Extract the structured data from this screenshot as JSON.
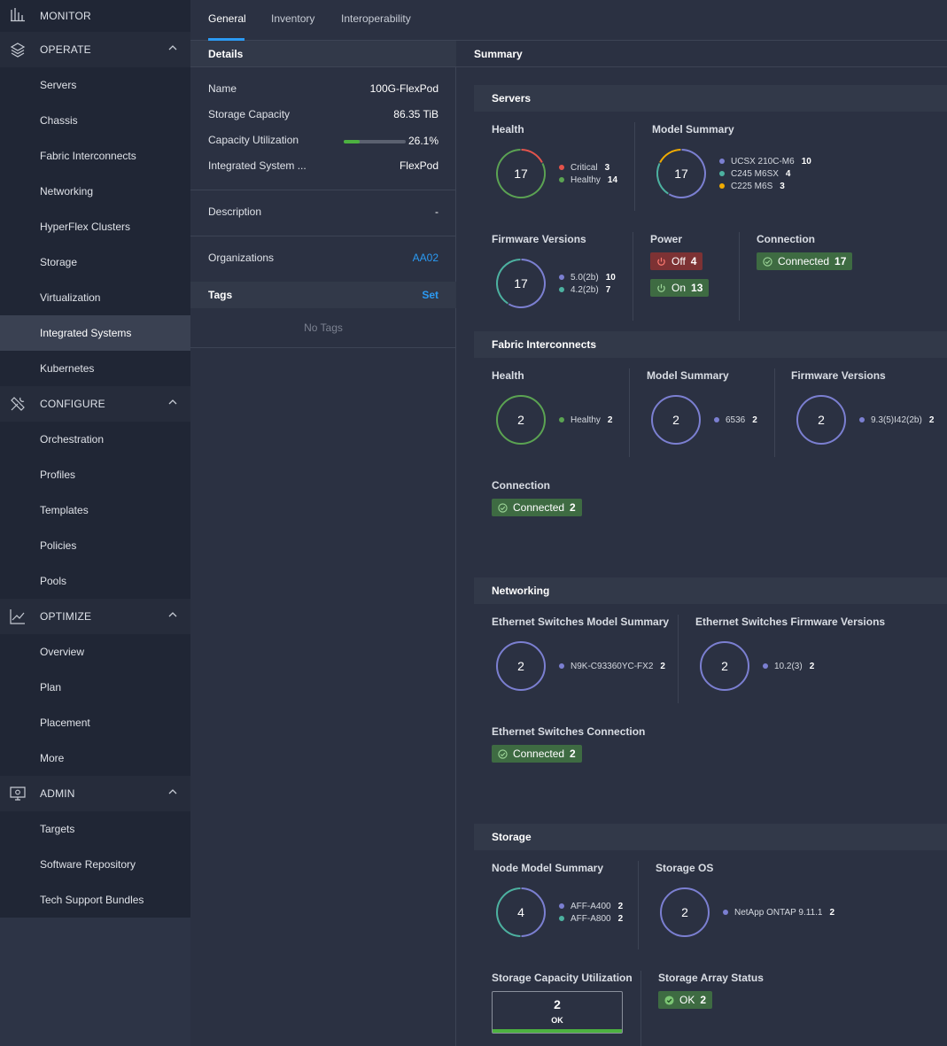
{
  "sidebar": {
    "monitor": "MONITOR",
    "operate": "OPERATE",
    "operate_items": [
      "Servers",
      "Chassis",
      "Fabric Interconnects",
      "Networking",
      "HyperFlex Clusters",
      "Storage",
      "Virtualization",
      "Integrated Systems",
      "Kubernetes"
    ],
    "configure": "CONFIGURE",
    "configure_items": [
      "Orchestration",
      "Profiles",
      "Templates",
      "Policies",
      "Pools"
    ],
    "optimize": "OPTIMIZE",
    "optimize_items": [
      "Overview",
      "Plan",
      "Placement",
      "More"
    ],
    "admin": "ADMIN",
    "admin_items": [
      "Targets",
      "Software Repository",
      "Tech Support Bundles"
    ]
  },
  "tabs": [
    "General",
    "Inventory",
    "Interoperability"
  ],
  "details": {
    "header": "Details",
    "name_label": "Name",
    "name_value": "100G-FlexPod",
    "storage_label": "Storage Capacity",
    "storage_value": "86.35 TiB",
    "util_label": "Capacity Utilization",
    "util_value": "26.1%",
    "util_fraction": 0.261,
    "type_label": "Integrated System ...",
    "type_value": "FlexPod",
    "desc_label": "Description",
    "desc_value": "-",
    "org_label": "Organizations",
    "org_value": "AA02",
    "tags_header": "Tags",
    "tags_action": "Set",
    "no_tags": "No Tags"
  },
  "summary": {
    "header": "Summary",
    "servers": {
      "title": "Servers",
      "health": {
        "title": "Health",
        "total": "17",
        "items": [
          {
            "label": "Critical",
            "count": "3",
            "color": "#e5534b"
          },
          {
            "label": "Healthy",
            "count": "14",
            "color": "#5ba352"
          }
        ]
      },
      "model": {
        "title": "Model Summary",
        "total": "17",
        "items": [
          {
            "label": "UCSX 210C-M6",
            "count": "10",
            "color": "#7b7fd1"
          },
          {
            "label": "C245 M6SX",
            "count": "4",
            "color": "#4cb1a0"
          },
          {
            "label": "C225 M6S",
            "count": "3",
            "color": "#f0ab00"
          }
        ]
      },
      "firmware": {
        "title": "Firmware Versions",
        "total": "17",
        "items": [
          {
            "label": "5.0(2b)",
            "count": "10",
            "color": "#7b7fd1"
          },
          {
            "label": "4.2(2b)",
            "count": "7",
            "color": "#4cb1a0"
          }
        ]
      },
      "power": {
        "title": "Power",
        "off_label": "Off",
        "off_count": "4",
        "on_label": "On",
        "on_count": "13"
      },
      "connection": {
        "title": "Connection",
        "label": "Connected",
        "count": "17"
      }
    },
    "fabric": {
      "title": "Fabric Interconnects",
      "health": {
        "title": "Health",
        "total": "2",
        "label": "Healthy",
        "count": "2"
      },
      "model": {
        "title": "Model Summary",
        "total": "2",
        "label": "6536",
        "count": "2"
      },
      "firmware": {
        "title": "Firmware Versions",
        "total": "2",
        "label": "9.3(5)I42(2b)",
        "count": "2"
      },
      "connection": {
        "title": "Connection",
        "label": "Connected",
        "count": "2"
      }
    },
    "networking": {
      "title": "Networking",
      "model": {
        "title": "Ethernet Switches Model Summary",
        "total": "2",
        "label": "N9K-C93360YC-FX2",
        "count": "2"
      },
      "firmware": {
        "title": "Ethernet Switches Firmware Versions",
        "total": "2",
        "label": "10.2(3)",
        "count": "2"
      },
      "connection": {
        "title": "Ethernet Switches Connection",
        "label": "Connected",
        "count": "2"
      }
    },
    "storage": {
      "title": "Storage",
      "node": {
        "title": "Node Model Summary",
        "total": "4",
        "items": [
          {
            "label": "AFF-A400",
            "count": "2",
            "color": "#7b7fd1"
          },
          {
            "label": "AFF-A800",
            "count": "2",
            "color": "#4cb1a0"
          }
        ]
      },
      "os": {
        "title": "Storage OS",
        "total": "2",
        "label": "NetApp ONTAP 9.11.1",
        "count": "2"
      },
      "capacity": {
        "title": "Storage Capacity Utilization",
        "value": "2",
        "status": "OK"
      },
      "array": {
        "title": "Storage Array Status",
        "label": "OK",
        "count": "2"
      }
    }
  },
  "colors": {
    "accent": "#2b9af3",
    "healthy": "#5ba352",
    "critical": "#e5534b",
    "purple": "#7b7fd1",
    "teal": "#4cb1a0",
    "amber": "#f0ab00"
  }
}
